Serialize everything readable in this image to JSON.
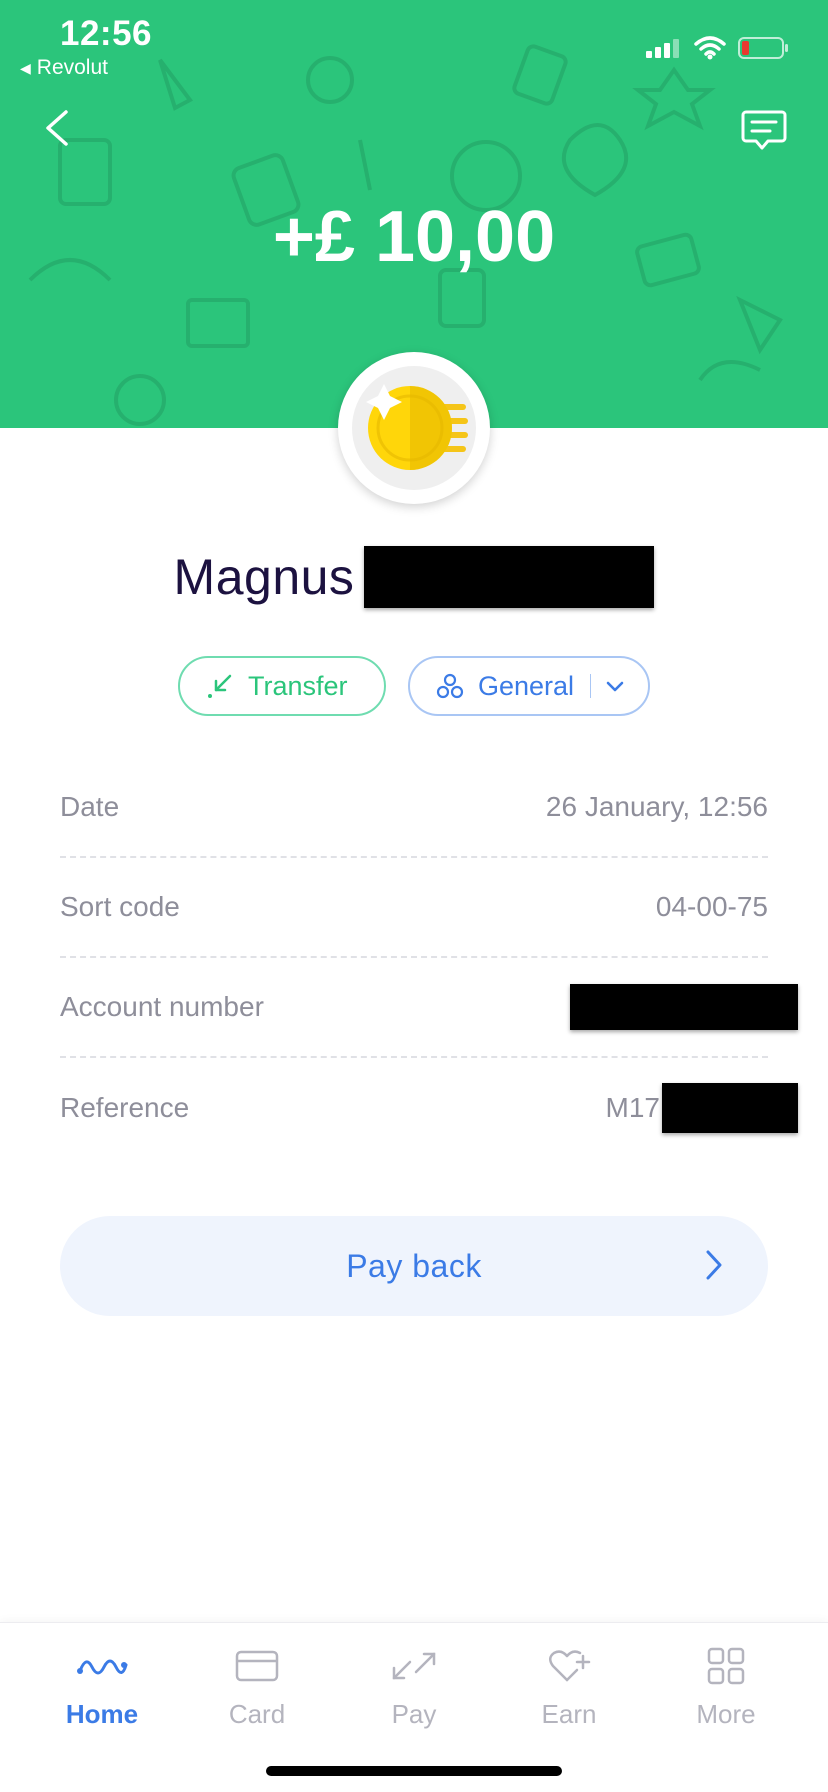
{
  "status_bar": {
    "time": "12:56",
    "back_app": "Revolut"
  },
  "header": {
    "amount": "+£ 10,00",
    "accent_color": "#2bc57b"
  },
  "merchant": {
    "name": "Magnus"
  },
  "chips": {
    "transfer_label": "Transfer",
    "category_label": "General"
  },
  "details": [
    {
      "key": "Date",
      "value": "26 January, 12:56"
    },
    {
      "key": "Sort code",
      "value": "04-00-75"
    },
    {
      "key": "Account number",
      "value": ""
    },
    {
      "key": "Reference",
      "value": "M17"
    }
  ],
  "actions": {
    "pay_back_label": "Pay back"
  },
  "tabbar": {
    "items": [
      {
        "label": "Home",
        "icon": "home-wave-icon",
        "active": true
      },
      {
        "label": "Card",
        "icon": "card-icon",
        "active": false
      },
      {
        "label": "Pay",
        "icon": "pay-arrows-icon",
        "active": false
      },
      {
        "label": "Earn",
        "icon": "heart-plus-icon",
        "active": false
      },
      {
        "label": "More",
        "icon": "grid-icon",
        "active": false
      }
    ]
  }
}
